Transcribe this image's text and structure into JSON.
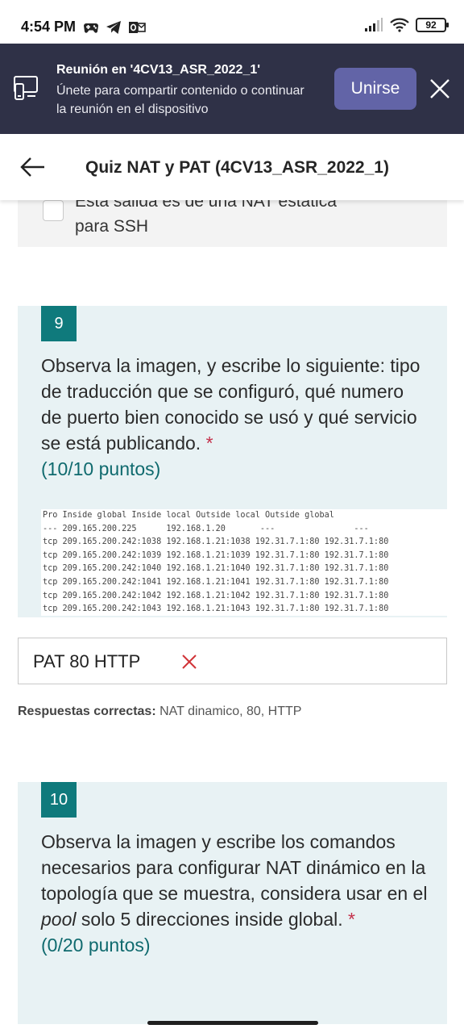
{
  "status_bar": {
    "time": "4:54 PM",
    "left_icons": [
      "game-controller-icon",
      "telegram-icon",
      "outlook-icon"
    ],
    "signal_icon": "signal-bars-icon",
    "wifi_icon": "wifi-icon",
    "battery": "92"
  },
  "banner": {
    "title": "Reunión en '4CV13_ASR_2022_1'",
    "description": "Únete para compartir contenido o continuar la reunión en el dispositivo",
    "join_label": "Unirse",
    "accent": "#6264a7",
    "background": "#2f3147"
  },
  "header": {
    "title": "Quiz NAT y PAT (4CV13_ASR_2022_1)"
  },
  "previous_option": {
    "text_cut": "Esta salida es de una NAT estática",
    "text": "para SSH"
  },
  "question9": {
    "number": "9",
    "text": "Observa la imagen, y escribe lo siguiente: tipo de traducción  que se configuró, qué numero de puerto bien conocido se usó y qué servicio se está publicando.",
    "required_mark": "*",
    "points": "(10/10 puntos)",
    "nat_table": {
      "header": "Pro Inside global Inside local Outside local Outside global",
      "rows": [
        "--- 209.165.200.225      192.168.1.20       ---                ---",
        "tcp 209.165.200.242:1038 192.168.1.21:1038 192.31.7.1:80 192.31.7.1:80",
        "tcp 209.165.200.242:1039 192.168.1.21:1039 192.31.7.1:80 192.31.7.1:80",
        "tcp 209.165.200.242:1040 192.168.1.21:1040 192.31.7.1:80 192.31.7.1:80",
        "tcp 209.165.200.242:1041 192.168.1.21:1041 192.31.7.1:80 192.31.7.1:80",
        "tcp 209.165.200.242:1042 192.168.1.21:1042 192.31.7.1:80 192.31.7.1:80",
        "tcp 209.165.200.242:1043 192.168.1.21:1043 192.31.7.1:80 192.31.7.1:80"
      ]
    },
    "answer": "PAT 80 HTTP",
    "answer_status_icon": "wrong-x-icon",
    "correct_label": "Respuestas correctas:",
    "correct_value": "NAT dinamico, 80, HTTP"
  },
  "question10": {
    "number": "10",
    "text_before_italic": "Observa la imagen y escribe los comandos necesarios para configurar NAT dinámico en la topología que se muestra, considera usar en el ",
    "text_italic": "pool",
    "text_after_italic": " solo 5 direcciones inside global.",
    "required_mark": "*",
    "points": "(0/20 puntos)"
  },
  "colors": {
    "teal": "#0f7a7c",
    "card_bg": "#e8f2f4",
    "required_red": "#c4314b",
    "wrong_red": "#d13438"
  }
}
